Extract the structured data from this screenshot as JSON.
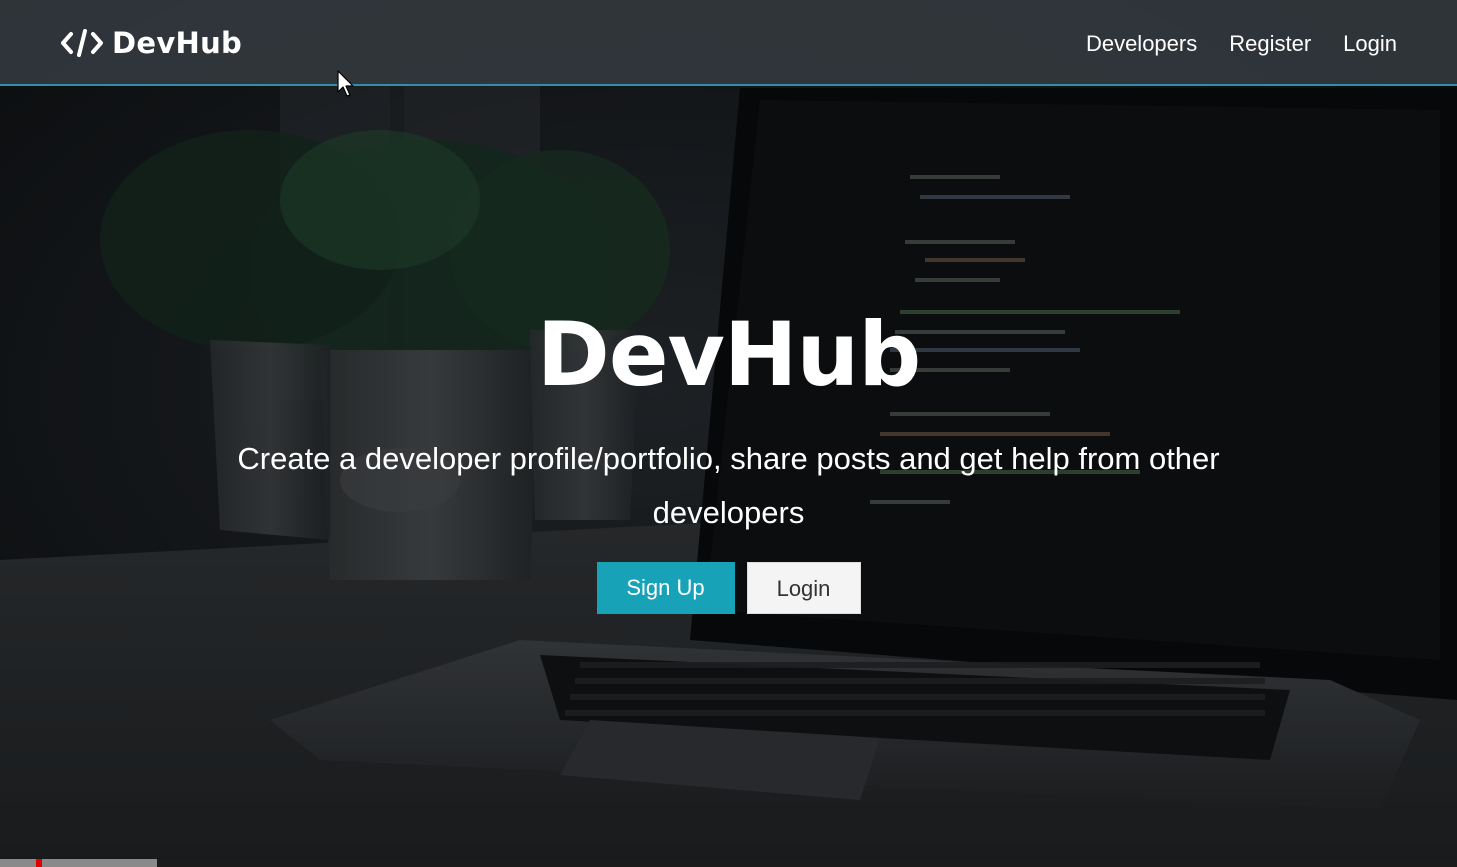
{
  "navbar": {
    "brand_icon": "code-icon",
    "brand_text": "DevHub",
    "links": [
      {
        "label": "Developers"
      },
      {
        "label": "Register"
      },
      {
        "label": "Login"
      }
    ]
  },
  "landing": {
    "title": "DevHub",
    "lead": "Create a developer profile/portfolio, share posts and get help from other developers",
    "buttons": {
      "sign_up": "Sign Up",
      "login": "Login"
    }
  },
  "theme": {
    "accent": "#17a2b8",
    "navbar_bg": "#343a40",
    "text": "#ffffff"
  },
  "video": {
    "progress": 0.108
  }
}
